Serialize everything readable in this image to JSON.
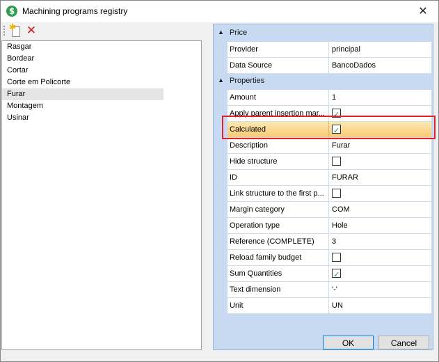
{
  "window": {
    "title": "Machining programs registry",
    "close_glyph": "✕",
    "app_icon": "dollar-icon"
  },
  "toolbar": {
    "new_icon": "new-document-icon",
    "delete_icon": "delete-icon"
  },
  "programs": [
    "Rasgar",
    "Bordear",
    "Cortar",
    "Corte em Policorte",
    "Furar",
    "Montagem",
    "Usinar"
  ],
  "selected_program": "Furar",
  "property_grid": {
    "categories": [
      {
        "label": "Price",
        "rows": [
          {
            "name": "Provider",
            "value": "principal"
          },
          {
            "name": "Data Source",
            "value": "BancoDados"
          }
        ]
      },
      {
        "label": "Properties",
        "rows": [
          {
            "name": "Amount",
            "value": "1"
          },
          {
            "name": "Apply parent insertion mar...",
            "checkbox": true,
            "checked": true
          },
          {
            "name": "Calculated",
            "checkbox": true,
            "checked": true,
            "highlighted": true
          },
          {
            "name": "Description",
            "value": "Furar"
          },
          {
            "name": "Hide structure",
            "checkbox": true,
            "checked": false
          },
          {
            "name": "ID",
            "value": "FURAR"
          },
          {
            "name": "Link structure to the first p...",
            "checkbox": true,
            "checked": false
          },
          {
            "name": "Margin category",
            "value": "COM"
          },
          {
            "name": "Operation type",
            "value": "Hole"
          },
          {
            "name": "Reference (COMPLETE)",
            "value": "3"
          },
          {
            "name": "Reload family budget",
            "checkbox": true,
            "checked": false
          },
          {
            "name": "Sum Quantities",
            "checkbox": true,
            "checked": true
          },
          {
            "name": "Text dimension",
            "value": "'-'"
          },
          {
            "name": "Unit",
            "value": "UN"
          }
        ]
      }
    ]
  },
  "buttons": {
    "ok": "OK",
    "cancel": "Cancel"
  },
  "colors": {
    "highlight": "#f8ca72",
    "annotation_box": "#e0232b",
    "category_band": "#c8daf1"
  }
}
